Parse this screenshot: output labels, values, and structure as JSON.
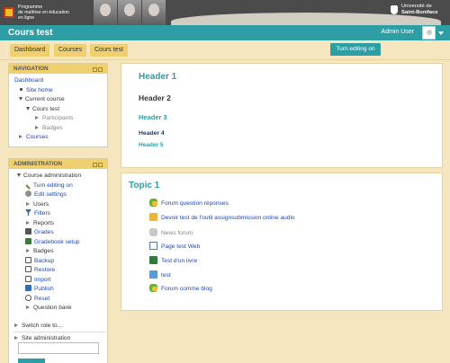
{
  "banner": {
    "left_logo_text": [
      "Programme",
      "de maîtrise en éducation",
      "en ligne"
    ],
    "right_logo_text": [
      "Université de",
      "Saint-Boniface"
    ]
  },
  "header": {
    "course_title": "Cours test",
    "user_name": "Admin User"
  },
  "breadcrumbs": [
    "Dashboard",
    "Courses",
    "Cours test"
  ],
  "edit_button": "Turn editing on",
  "navigation_block": {
    "title": "NAVIGATION",
    "dashboard": "Dashboard",
    "site_home": "Site home",
    "current_course": "Current course",
    "course": "Cours test",
    "participants": "Participants",
    "badges": "Badges",
    "courses": "Courses"
  },
  "administration_block": {
    "title": "ADMINISTRATION",
    "course_admin": "Course administration",
    "items": [
      {
        "label": "Turn editing on",
        "icon": "pencil-icon",
        "color": "#8a6d3b"
      },
      {
        "label": "Edit settings",
        "icon": "gear-icon",
        "color": "#7a7a7a"
      },
      {
        "label": "Users",
        "icon": "chevron-right-icon",
        "color": "#777777"
      },
      {
        "label": "Filters",
        "icon": "filter-icon",
        "color": "#2f6fb3"
      },
      {
        "label": "Reports",
        "icon": "chevron-right-icon",
        "color": "#777777"
      },
      {
        "label": "Grades",
        "icon": "grades-icon",
        "color": "#555555"
      },
      {
        "label": "Gradebook setup",
        "icon": "gradebook-icon",
        "color": "#3b7a3b"
      },
      {
        "label": "Badges",
        "icon": "chevron-right-icon",
        "color": "#777777"
      },
      {
        "label": "Backup",
        "icon": "backup-icon",
        "color": "#555555"
      },
      {
        "label": "Restore",
        "icon": "restore-icon",
        "color": "#555555"
      },
      {
        "label": "Import",
        "icon": "import-icon",
        "color": "#555555"
      },
      {
        "label": "Publish",
        "icon": "publish-icon",
        "color": "#2f6fb3"
      },
      {
        "label": "Reset",
        "icon": "reset-icon",
        "color": "#555555"
      },
      {
        "label": "Question bank",
        "icon": "chevron-right-icon",
        "color": "#777777"
      }
    ],
    "switch_role": "Switch role to...",
    "site_admin": "Site administration"
  },
  "main": {
    "h1": "Header 1",
    "h2": "Header 2",
    "h3": "Header 3",
    "h4": "Header 4",
    "h5": "Header 5",
    "topic_title": "Topic 1",
    "activities": [
      {
        "label": "Forum question réponses",
        "icon": "forum-icon",
        "link": true
      },
      {
        "label": "Devoir test de l'outil assignsubmission online audio",
        "icon": "assignment-icon",
        "link": true
      },
      {
        "label": "News forum",
        "icon": "news-forum-icon",
        "link": false
      },
      {
        "label": "Page test Web",
        "icon": "page-icon",
        "link": true
      },
      {
        "label": "Test d'un livre",
        "icon": "book-icon",
        "link": true
      },
      {
        "label": "test",
        "icon": "folder-icon",
        "link": true
      },
      {
        "label": "Forum comme blog",
        "icon": "forum-icon",
        "link": true
      }
    ]
  },
  "colors": {
    "accent": "#2e9ea5",
    "block_header": "#f0cf6e",
    "page_bg": "#f5e6bf",
    "link": "#1b47c4"
  }
}
